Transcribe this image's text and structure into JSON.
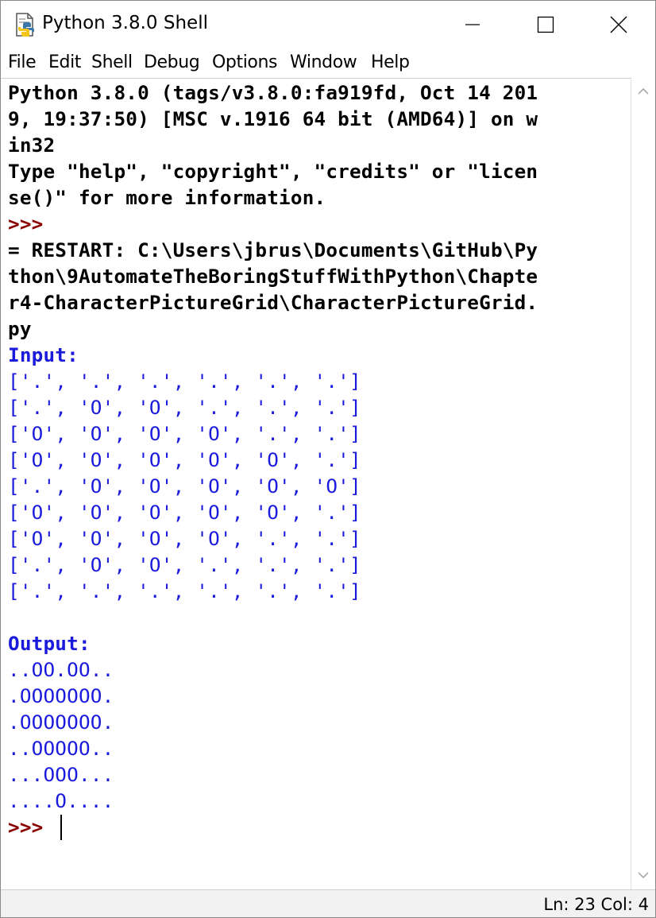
{
  "window": {
    "title": "Python 3.8.0 Shell",
    "icon": "python-idle-icon"
  },
  "menu": [
    "File",
    "Edit",
    "Shell",
    "Debug",
    "Options",
    "Window",
    "Help"
  ],
  "shell": {
    "banner": [
      "Python 3.8.0 (tags/v3.8.0:fa919fd, Oct 14 201",
      "9, 19:37:50) [MSC v.1916 64 bit (AMD64)] on w",
      "in32",
      "Type \"help\", \"copyright\", \"credits\" or \"licen",
      "se()\" for more information."
    ],
    "prompt": ">>>",
    "restart": [
      "= RESTART: C:\\Users\\jbrus\\Documents\\GitHub\\Py",
      "thon\\9AutomateTheBoringStuffWithPython\\Chapte",
      "r4-CharacterPictureGrid\\CharacterPictureGrid.",
      "py"
    ],
    "input_label": "Input:",
    "input_rows": [
      "['.', '.', '.', '.', '.', '.']",
      "['.', 'O', 'O', '.', '.', '.']",
      "['O', 'O', 'O', 'O', '.', '.']",
      "['O', 'O', 'O', 'O', 'O', '.']",
      "['.', 'O', 'O', 'O', 'O', 'O']",
      "['O', 'O', 'O', 'O', 'O', '.']",
      "['O', 'O', 'O', 'O', '.', '.']",
      "['.', 'O', 'O', '.', '.', '.']",
      "['.', '.', '.', '.', '.', '.']"
    ],
    "output_label": "Output:",
    "output_rows": [
      "..OO.OO..",
      ".OOOOOOO.",
      ".OOOOOOO.",
      "..OOOOO..",
      "...OOO...",
      "....O...."
    ]
  },
  "status": {
    "text": "Ln: 23  Col: 4"
  },
  "colors": {
    "prompt": "#8b0000",
    "output": "#1a1add",
    "stdout_text": "#000000"
  }
}
